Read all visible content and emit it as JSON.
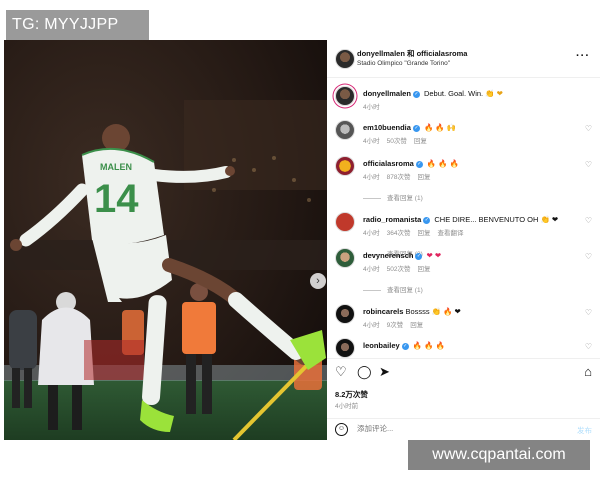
{
  "watermarks": {
    "top": "TG: MYYJJPP",
    "bottom": "www.cqpantai.com"
  },
  "post": {
    "header": {
      "names": "donyellmalen 和 officialasroma",
      "location": "Stadio Olimpico \"Grande Torino\"",
      "more": "···"
    },
    "image": {
      "player_name": "MALEN",
      "player_number": "14",
      "jersey_color": "#eef2ee",
      "trim_color": "#3b8f4a",
      "boot_color": "#9be23a",
      "steward_vest_color": "#f07a3a",
      "carousel_next": "›",
      "tag_badge": "●"
    },
    "caption": {
      "user": "donyellmalen",
      "text": "Debut. Goal. Win.",
      "emojis": "👏 ❤",
      "time": "4小时"
    },
    "comments": [
      {
        "user": "em10buendia",
        "text": "🔥 🔥 🙌",
        "time": "4小时",
        "likes": "50次赞",
        "reply": "回复",
        "verified": true
      },
      {
        "user": "officialasroma",
        "text": "🔥 🔥 🔥",
        "time": "4小时",
        "likes": "878次赞",
        "reply": "回复",
        "verified": true,
        "view_replies": "查看回复 (1)"
      },
      {
        "user": "radio_romanista",
        "text": "CHE DIRE... BENVENUTO OH 👏 ❤",
        "time": "4小时",
        "likes": "364次赞",
        "reply": "回复",
        "translate": "查看翻译",
        "verified": true,
        "view_replies": "查看回复 (3)"
      },
      {
        "user": "devynerensch",
        "text": "❤ ❤",
        "time": "4小时",
        "likes": "502次赞",
        "reply": "回复",
        "verified": true,
        "view_replies": "查看回复 (1)"
      },
      {
        "user": "robincarels",
        "text": "Bossss 👏 🔥 ❤",
        "time": "4小时",
        "likes": "9次赞",
        "reply": "回复",
        "verified": false
      },
      {
        "user": "leonbailey",
        "text": "🔥 🔥 🔥",
        "time": "4小时",
        "likes": "",
        "reply": "",
        "verified": true
      }
    ],
    "likes": "8.2万次赞",
    "time_ago": "4小时前",
    "add_comment": {
      "placeholder": "添加评论...",
      "post_label": "发布"
    }
  },
  "icons": [
    "heart-icon",
    "comment-icon",
    "share-icon",
    "bookmark-icon",
    "emoji-icon",
    "more-icon",
    "verified-icon"
  ]
}
